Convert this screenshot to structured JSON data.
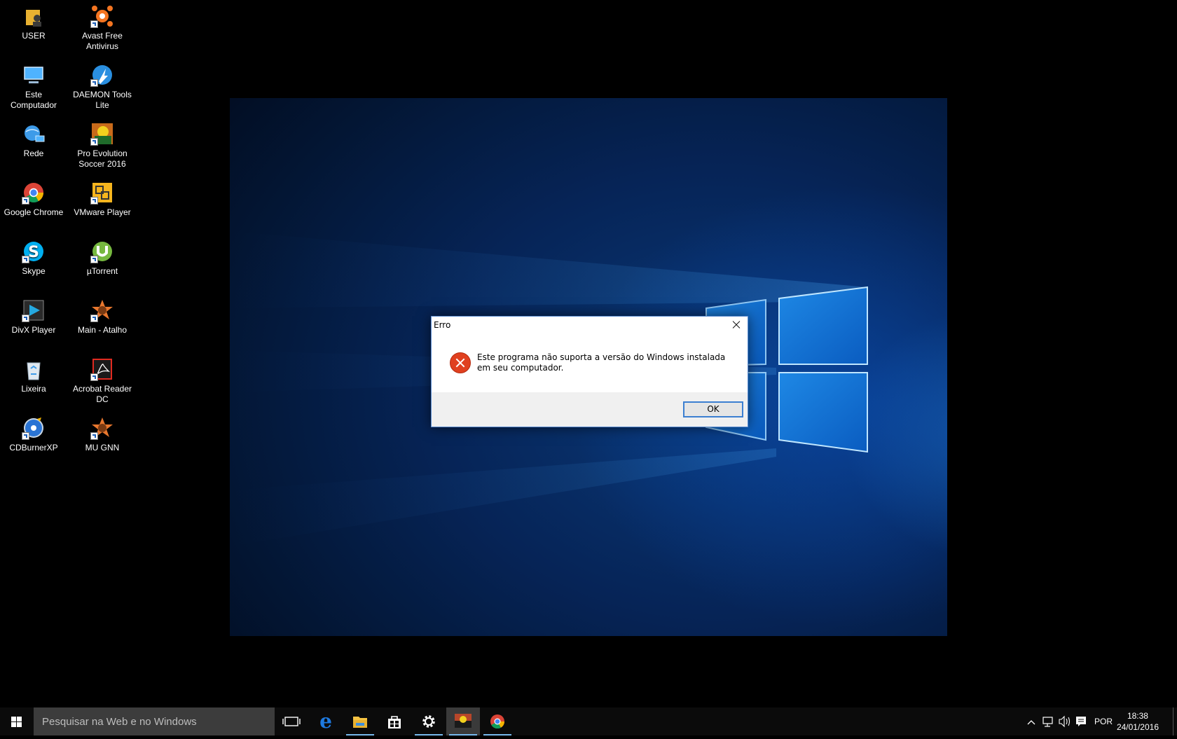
{
  "desktop": {
    "icons": [
      {
        "label": "USER",
        "icon": "user-folder-icon",
        "col": 0,
        "row": 0
      },
      {
        "label": "Avast Free Antivirus",
        "icon": "avast-icon",
        "col": 1,
        "row": 0
      },
      {
        "label": "Este Computador",
        "icon": "computer-icon",
        "col": 0,
        "row": 1
      },
      {
        "label": "DAEMON Tools Lite",
        "icon": "daemon-tools-icon",
        "col": 1,
        "row": 1
      },
      {
        "label": "Rede",
        "icon": "network-icon",
        "col": 0,
        "row": 2
      },
      {
        "label": "Pro Evolution Soccer 2016",
        "icon": "pes-icon",
        "col": 1,
        "row": 2
      },
      {
        "label": "Google Chrome",
        "icon": "chrome-icon",
        "col": 0,
        "row": 3
      },
      {
        "label": "VMware Player",
        "icon": "vmware-icon",
        "col": 1,
        "row": 3
      },
      {
        "label": "Skype",
        "icon": "skype-icon",
        "col": 0,
        "row": 4
      },
      {
        "label": "µTorrent",
        "icon": "utorrent-icon",
        "col": 1,
        "row": 4
      },
      {
        "label": "DivX Player",
        "icon": "divx-icon",
        "col": 0,
        "row": 5
      },
      {
        "label": "Main - Atalho",
        "icon": "mu-icon",
        "col": 1,
        "row": 5
      },
      {
        "label": "Lixeira",
        "icon": "recycle-bin-icon",
        "col": 0,
        "row": 6
      },
      {
        "label": "Acrobat Reader DC",
        "icon": "acrobat-icon",
        "col": 1,
        "row": 6
      },
      {
        "label": "CDBurnerXP",
        "icon": "cdburner-icon",
        "col": 0,
        "row": 7
      },
      {
        "label": "MU GNN",
        "icon": "mu-icon",
        "col": 1,
        "row": 7
      }
    ]
  },
  "dialog": {
    "title": "Erro",
    "message": "Este programa não suporta a versão do Windows instalada em seu computador.",
    "ok_label": "OK",
    "icon": "error-icon"
  },
  "taskbar": {
    "search_placeholder": "Pesquisar na Web e no Windows",
    "apps": [
      "task-view-icon",
      "edge-icon",
      "file-explorer-icon",
      "store-icon",
      "settings-icon",
      "pes-icon",
      "chrome-icon"
    ],
    "language": "POR",
    "time": "18:38",
    "date": "24/01/2016"
  },
  "colors": {
    "accent": "#76b9ed",
    "error_red": "#e0401f",
    "taskbar_bg": "#0b0b0b"
  }
}
